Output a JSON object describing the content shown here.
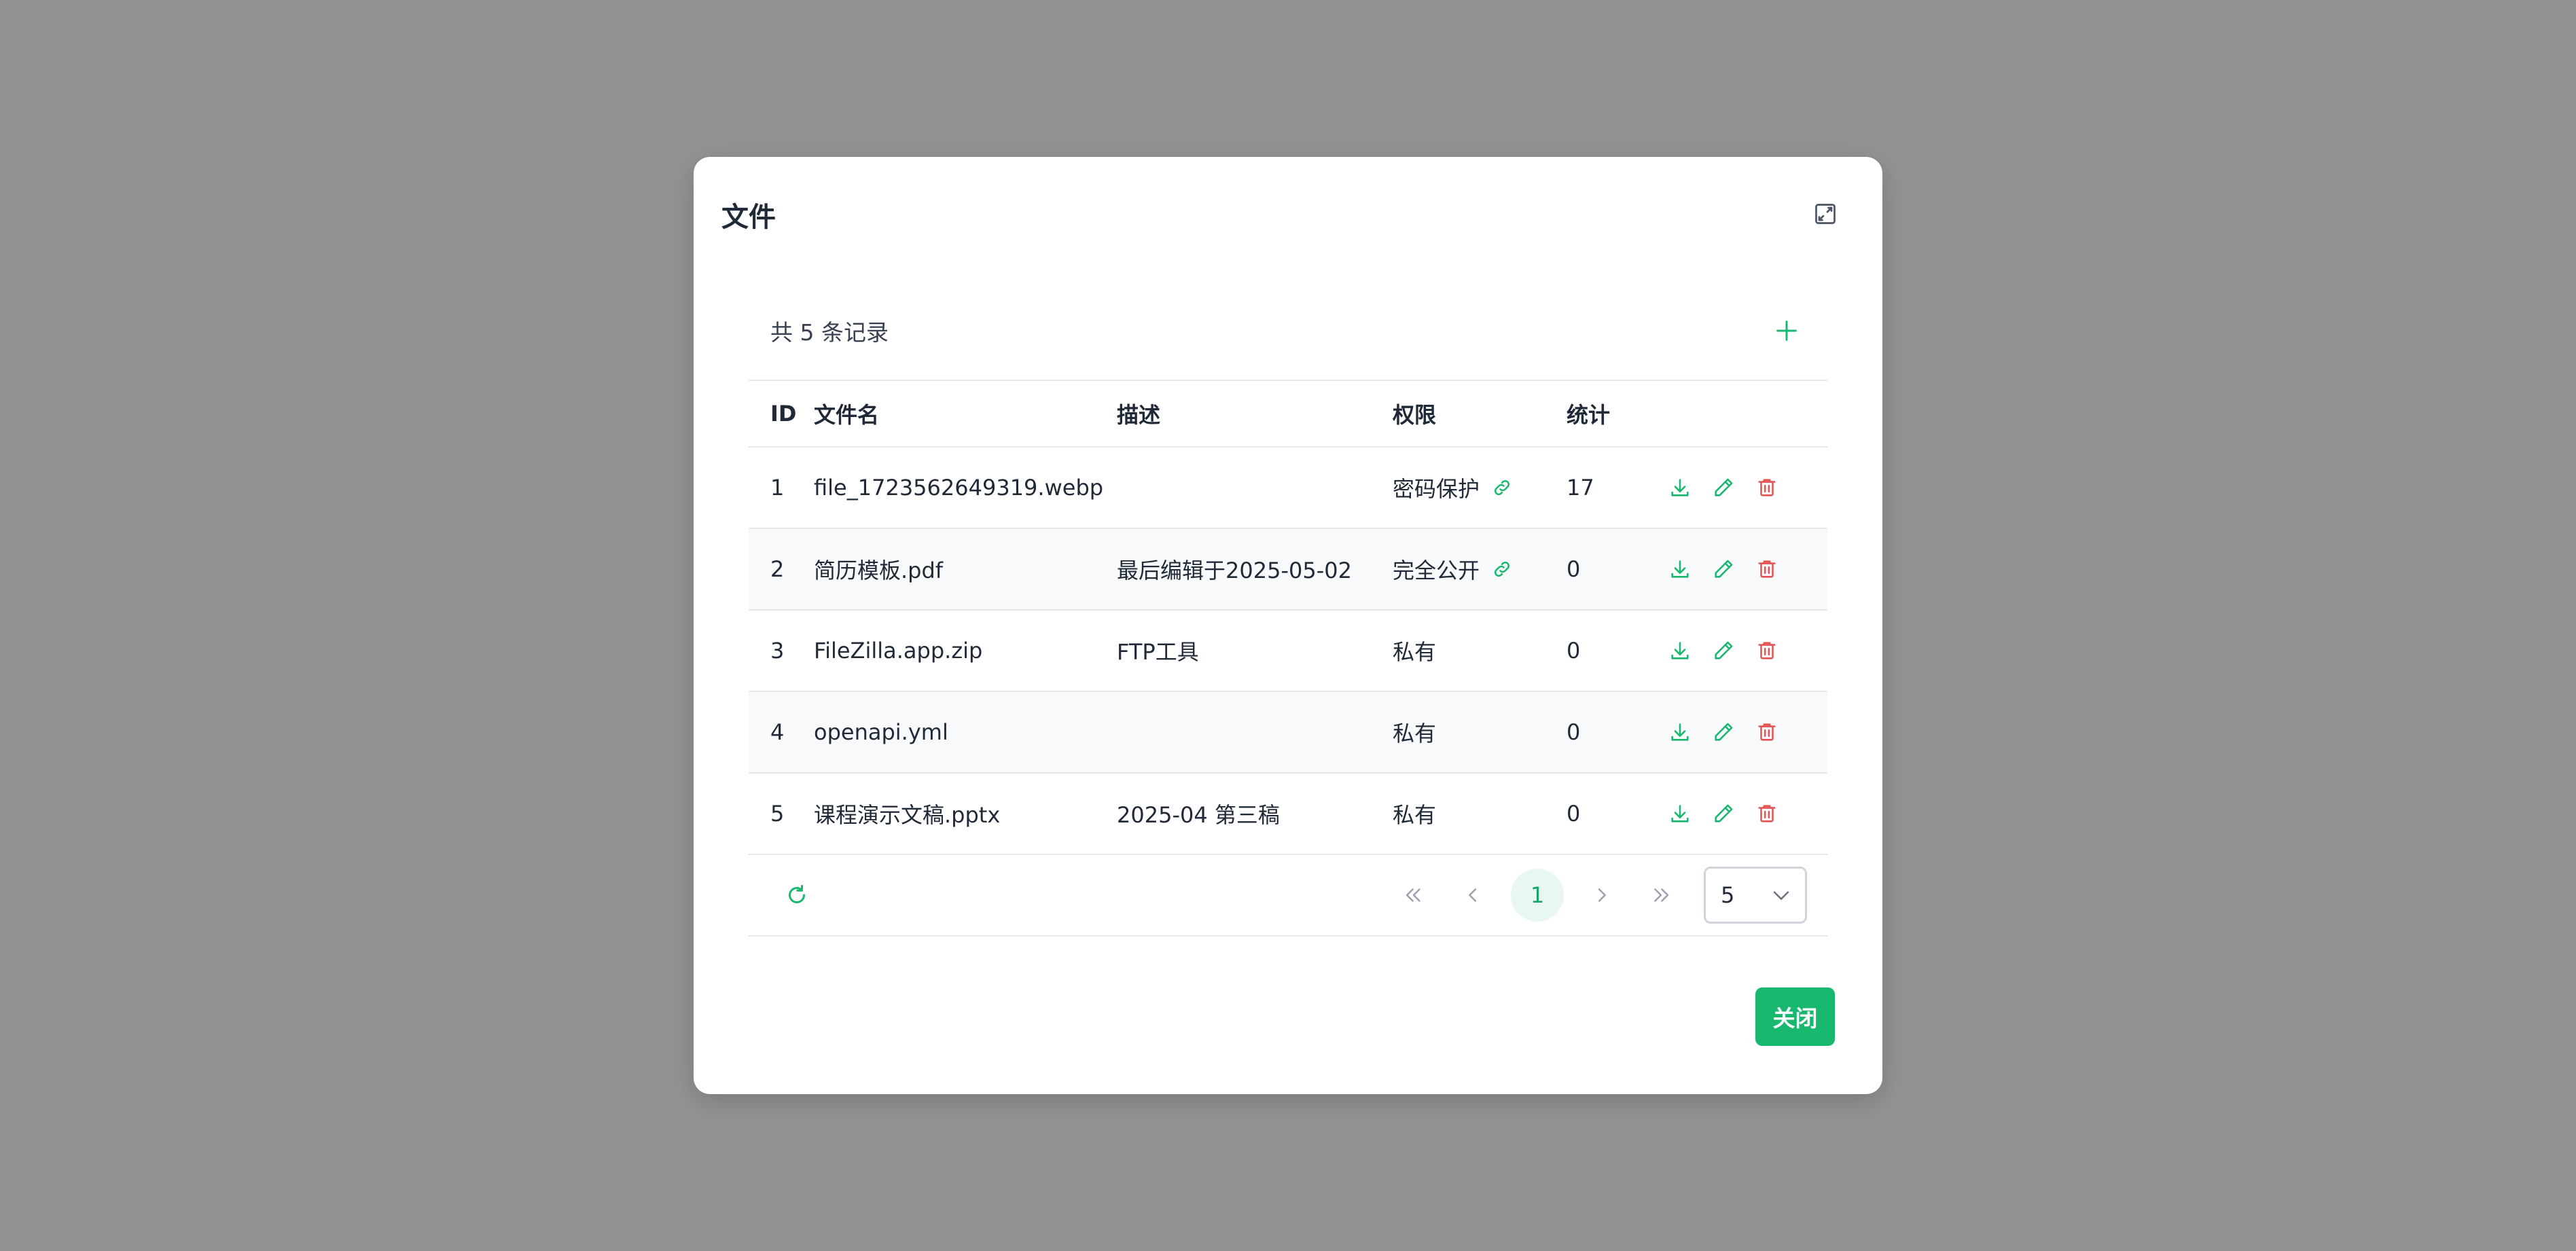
{
  "modal": {
    "title": "文件",
    "close_label": "关闭"
  },
  "toolbar": {
    "record_count": "共 5 条记录"
  },
  "table": {
    "headers": {
      "id": "ID",
      "name": "文件名",
      "desc": "描述",
      "perm": "权限",
      "stat": "统计"
    },
    "rows": [
      {
        "id": "1",
        "name": "file_1723562649319.webp",
        "desc": "",
        "perm": "密码保护",
        "link": true,
        "stat": "17"
      },
      {
        "id": "2",
        "name": "简历模板.pdf",
        "desc": "最后编辑于2025-05-02",
        "perm": "完全公开",
        "link": true,
        "stat": "0"
      },
      {
        "id": "3",
        "name": "FileZilla.app.zip",
        "desc": "FTP工具",
        "perm": "私有",
        "link": false,
        "stat": "0"
      },
      {
        "id": "4",
        "name": "openapi.yml",
        "desc": "",
        "perm": "私有",
        "link": false,
        "stat": "0"
      },
      {
        "id": "5",
        "name": "课程演示文稿.pptx",
        "desc": "2025-04 第三稿",
        "perm": "私有",
        "link": false,
        "stat": "0"
      }
    ]
  },
  "pagination": {
    "current_page": "1",
    "page_size": "5"
  },
  "icons": {
    "expand": "expand-icon",
    "add": "plus-icon",
    "download": "download-icon",
    "edit": "pencil-icon",
    "delete": "trash-icon",
    "link": "link-icon",
    "refresh": "refresh-icon",
    "first": "double-chevron-left-icon",
    "prev": "chevron-left-icon",
    "next": "chevron-right-icon",
    "last": "double-chevron-right-icon",
    "dropdown": "chevron-down-icon"
  },
  "colors": {
    "accent": "#18b86f",
    "danger": "#e35555",
    "overlay": "#939393"
  }
}
